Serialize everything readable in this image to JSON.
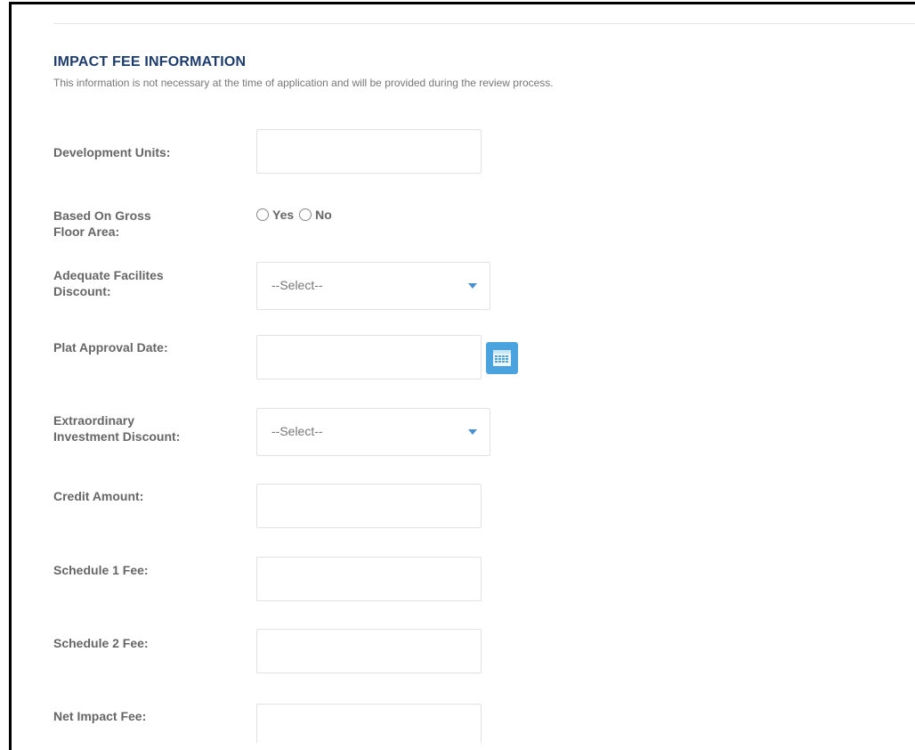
{
  "section": {
    "title": "IMPACT FEE INFORMATION",
    "note": "This information is not necessary at the time of application and will be provided during the review process."
  },
  "fields": {
    "development_units": {
      "label": "Development Units:",
      "value": ""
    },
    "gross_floor_area": {
      "label_line1": "Based On Gross",
      "label_line2": "Floor Area:",
      "options": [
        "Yes",
        "No"
      ]
    },
    "adequate_facilities": {
      "label_line1": "Adequate Facilites",
      "label_line2": "Discount:",
      "selected": "--Select--"
    },
    "plat_approval_date": {
      "label": "Plat Approval Date:",
      "value": ""
    },
    "extraordinary_investment": {
      "label_line1": "Extraordinary",
      "label_line2": "Investment Discount:",
      "selected": "--Select--"
    },
    "credit_amount": {
      "label": "Credit Amount:",
      "value": ""
    },
    "schedule_1_fee": {
      "label": "Schedule 1 Fee:",
      "value": ""
    },
    "schedule_2_fee": {
      "label": "Schedule 2 Fee:",
      "value": ""
    },
    "net_impact_fee": {
      "label": "Net Impact Fee:",
      "value": ""
    }
  },
  "icons": {
    "calendar": "calendar-icon",
    "dropdown": "chevron-down-icon"
  },
  "colors": {
    "title": "#1d3c6e",
    "accent": "#4aa3df",
    "label": "#666666"
  }
}
